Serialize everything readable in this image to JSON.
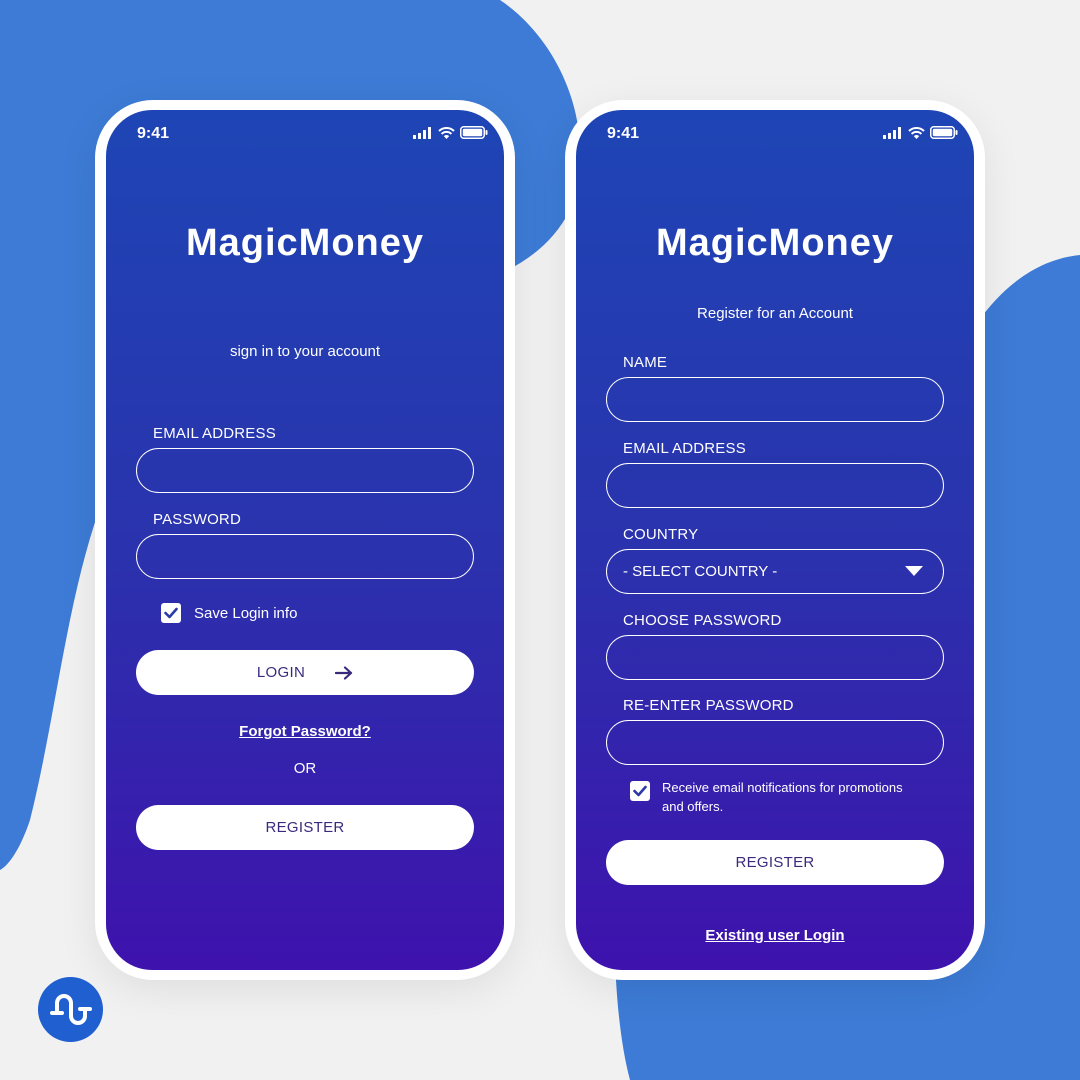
{
  "colors": {
    "blob": "#3d7bd6",
    "page_bg": "#f1f1f1",
    "screen_top": "#1e45b5",
    "screen_bottom": "#3e12ad",
    "button_text": "#3a2a7e",
    "badge": "#1f5fd0"
  },
  "login_screen": {
    "status": {
      "time": "9:41"
    },
    "brand": "MagicMoney",
    "subtitle": "sign in to your account",
    "email_label": "EMAIL ADDRESS",
    "email_value": "",
    "password_label": "PASSWORD",
    "password_value": "",
    "save_login": {
      "label": "Save Login info",
      "checked": true
    },
    "login_button": "LOGIN",
    "forgot_password": "Forgot Password?",
    "or_text": "OR",
    "register_button": "REGISTER"
  },
  "register_screen": {
    "status": {
      "time": "9:41"
    },
    "brand": "MagicMoney",
    "subtitle": "Register for an Account",
    "name_label": "NAME",
    "name_value": "",
    "email_label": "EMAIL ADDRESS",
    "email_value": "",
    "country_label": "COUNTRY",
    "country_selected": "- SELECT COUNTRY -",
    "password_label": "CHOOSE PASSWORD",
    "password_value": "",
    "reenter_label": "RE-ENTER PASSWORD",
    "reenter_value": "",
    "promo": {
      "label_line1": "Receive email notifications for promotions",
      "label_line2": "and offers.",
      "checked": true
    },
    "register_button": "REGISTER",
    "existing_login": "Existing user Login"
  },
  "icons": {
    "signal": "signal-icon",
    "wifi": "wifi-icon",
    "battery": "battery-icon",
    "arrow": "arrow-right-icon",
    "check": "checkmark-icon",
    "dropdown": "dropdown-triangle-icon",
    "logo": "brand-logo-icon"
  }
}
